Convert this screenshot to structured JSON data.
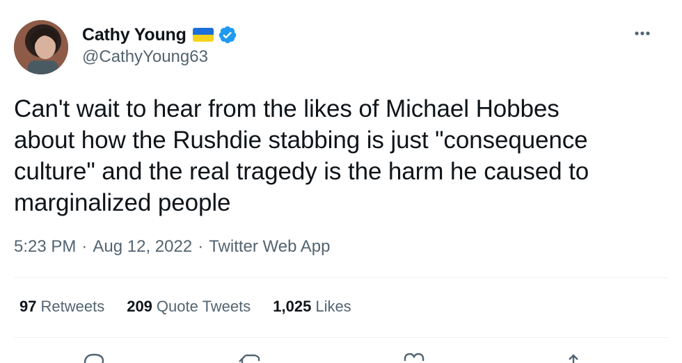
{
  "user": {
    "display_name": "Cathy Young",
    "handle": "@CathyYoung63",
    "flag_icon": "ukraine-flag-icon",
    "verified_icon": "verified-badge-icon",
    "verified_color": "#1d9bf0"
  },
  "tweet": {
    "text": "Can't wait to hear from the likes of Michael Hobbes\nabout how the Rushdie stabbing is just \"consequence\nculture\" and the real tragedy is the harm he caused to\nmarginalized people",
    "time": "5:23 PM",
    "date": "Aug 12, 2022",
    "source": "Twitter Web App",
    "separator": "·"
  },
  "stats": {
    "retweets_count": "97",
    "retweets_label": "Retweets",
    "quotes_count": "209",
    "quotes_label": "Quote Tweets",
    "likes_count": "1,025",
    "likes_label": "Likes"
  },
  "icons": {
    "more": "more-options-icon",
    "reply": "reply-icon",
    "retweet": "retweet-icon",
    "like": "like-icon",
    "share": "share-icon"
  },
  "colors": {
    "text_primary": "#0f1419",
    "text_secondary": "#536471",
    "divider": "#eff3f4",
    "flag_blue": "#1d6fd8",
    "flag_yellow": "#f7d21c"
  }
}
